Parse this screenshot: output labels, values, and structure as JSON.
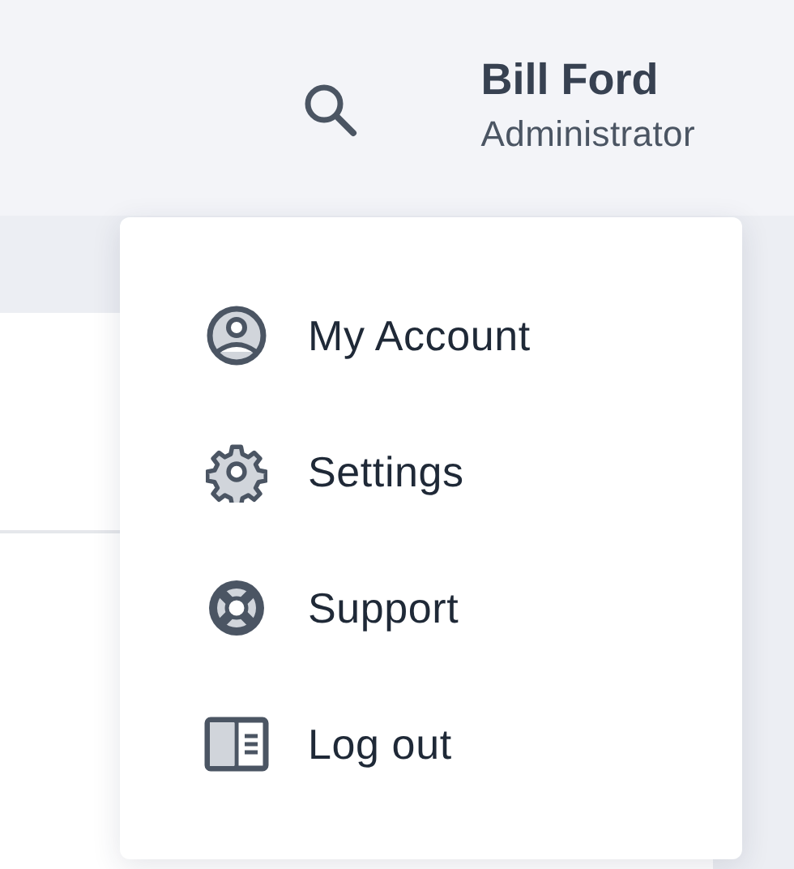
{
  "header": {
    "user": {
      "name": "Bill Ford",
      "role": "Administrator"
    }
  },
  "user_menu": {
    "open": true,
    "items": [
      {
        "kind": "account",
        "label": "My Account"
      },
      {
        "kind": "settings",
        "label": "Settings"
      },
      {
        "kind": "support",
        "label": "Support"
      },
      {
        "kind": "logout",
        "label": "Log out"
      }
    ]
  }
}
